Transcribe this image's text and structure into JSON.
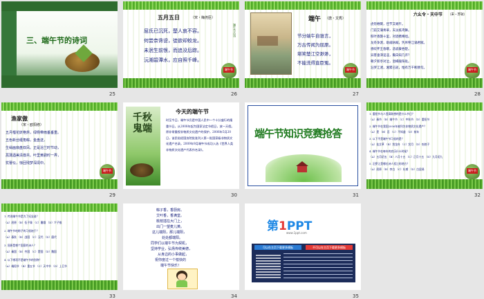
{
  "slides": {
    "s25": {
      "num": "25",
      "title": "三、端午节的诗词"
    },
    "s26": {
      "num": "26",
      "title": "五月五日",
      "author": "（宋・梅尧臣）",
      "lines": [
        "屈氏已沉死，楚人哀不容。",
        "何尝奈谗谤，徒欲却蛟龙。",
        "未泯生前恨，而追没后踪。",
        "沅湘碧潭水，应自照千峰。"
      ]
    },
    "s27": {
      "num": "27",
      "title": "端午",
      "author": "（唐・文秀）",
      "lines": [
        "节分端午自谁言，",
        "万古传闻为屈原。",
        "堪笑楚江空渺渺，",
        "不能洗得直臣冤。"
      ]
    },
    "s28": {
      "num": "28",
      "title": "六幺令・天中节",
      "author": "（宋・苏轼）",
      "lines": [
        "虎符缠臂，佳节又端午。",
        "门前艾蒲青翠，天淡纸鸢舞。",
        "粽叶香飘十里，对酒携樽俎。",
        "龙舟争渡，助威呐喊，凭吊祭江诵君赋。",
        "感叹怀王昏聩，悲戚秦吞楚。",
        "异客垂涕淫淫，鬓白知几许？",
        "朝夕新亭对泣，泪竭陵阳处。",
        "汨罗江渚，湘累已逝，惟有万千断肠句。"
      ]
    },
    "s29": {
      "num": "29",
      "title": "渔家傲",
      "author": "（宋・欧阳修）",
      "lines": [
        "五月榴花妖艳烘，绿杨带雨垂垂重。",
        "五色新丝缠角粽，金盘送，",
        "生绡画扇盘双凤。正是浴兰时节动，",
        "菖蒲酒美清尊共。叶里黄鹂时一弄，",
        "犹瞢忪，惊回残梦深闺中。"
      ]
    },
    "s30": {
      "num": "30",
      "title": "今天的端午节",
      "calligraphy": "千秋鬼端",
      "body": "时至今日，端午节仍是中国人民中一个十分盛行的隆重节日。从2008年起为国家法定节假日，放一天假。原非常重视非物质文化遗产的保护，2006年5月20日，该民俗经国务院批准列入第一批国家级非物质文化遗产名录。2009年9月端午节成功入选《世界人类非物质文化遗产代表作名录》。"
    },
    "s31": {
      "num": "31",
      "title": "端午节知识竞赛抢答"
    },
    "s32": {
      "num": "32",
      "questions": [
        "1. 重阳节与人登高联想的是什么节日？",
        "（A）春节 （B）端午节 （C）中秋节 （D）重阳节",
        "2. 端午节在我国2006年被列为非物质文化遗产？",
        "（A）是 （B）否 （C）不知道 （D）前年",
        "3. 以下不是端午节习俗的是？",
        "（A）挂艾草 （B）划龙舟 （C）赏月 （D）吃粽子",
        "4. 端午节在每年的农历什么时候？",
        "（A）五月初五 （B）八月十五 （C）正月十五 （D）九月初九",
        "5. 汨罗江是哪位诗人投江的地方？",
        "（A）屈原 （B）李白 （C）杜甫 （D）白居易"
      ]
    },
    "s33": {
      "num": "33",
      "questions": [
        "1. 传说端午节是为了纪念谁？",
        "（A）屈原 （B）伍子胥 （C）曹娥 （D）介子推",
        "2. 端午节吃粽子的习俗始于？",
        "（A）春秋 （B）战国 （C）汉代 （D）唐代",
        "3. 屈原是哪个国家的诗人？",
        "（A）秦国 （B）齐国 （C）楚国 （D）魏国",
        "4. 以下哪项不是端午节的别称？",
        "（A）端阳节 （B）重五节 （C）天中节 （D）上巳节"
      ]
    },
    "s34": {
      "num": "34",
      "lines": [
        "粽子香，香厨房。",
        "艾叶香，香满堂。",
        "桃枝插在大门上，",
        "出门一望麦儿黄。",
        "这儿端阳，那儿端阳，",
        "处处都端阳。",
        "同学们以端午节为契机，",
        "坚持学业，弘扬传统美德，",
        "从身边的小事做起，",
        "祝你度过一个愉快的",
        "端午节快乐！"
      ],
      "card_title": "端午节快乐"
    },
    "s35": {
      "num": "35",
      "logo_main": "第",
      "logo_num": "1",
      "logo_ppt": "PPT",
      "logo_url": "www.1ppt.com",
      "btn1": "可以在主页下载更多模板",
      "btn2": "不可以在主页下载更多模板"
    }
  },
  "colors": {
    "grass": "#4da327",
    "title_green": "#1f6b1a",
    "navy": "#1a237e",
    "brand_blue": "#1e88e5",
    "brand_red": "#e53935"
  }
}
